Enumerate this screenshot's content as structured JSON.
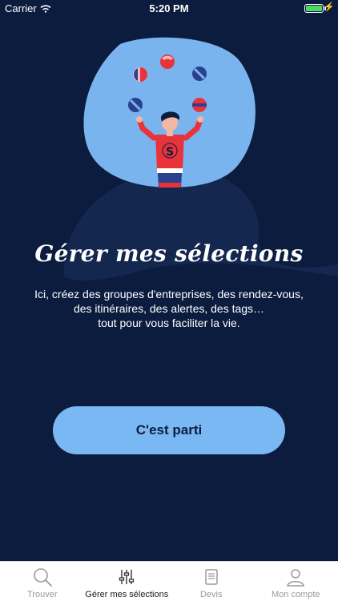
{
  "status_bar": {
    "carrier": "Carrier",
    "time": "5:20 PM"
  },
  "onboarding": {
    "title": "Gérer mes sélections",
    "lines": [
      "Ici, créez des groupes d'entreprises, des rendez-vous,",
      "des itinéraires, des alertes, des tags…",
      "tout pour vous faciliter la vie."
    ],
    "cta_label": "C'est parti",
    "illustration_letter": "S"
  },
  "tab_bar": {
    "items": [
      {
        "label": "Trouver",
        "icon": "search-icon",
        "active": false
      },
      {
        "label": "Gérer mes sélections",
        "icon": "sliders-icon",
        "active": true
      },
      {
        "label": "Devis",
        "icon": "document-icon",
        "active": false
      },
      {
        "label": "Mon compte",
        "icon": "user-icon",
        "active": false
      }
    ]
  },
  "colors": {
    "background_dark": "#0c1c3e",
    "hill": "#10234b",
    "bubble": "#7ab4ef",
    "button": "#79b8f2",
    "hero_suit": "#e8333b"
  }
}
